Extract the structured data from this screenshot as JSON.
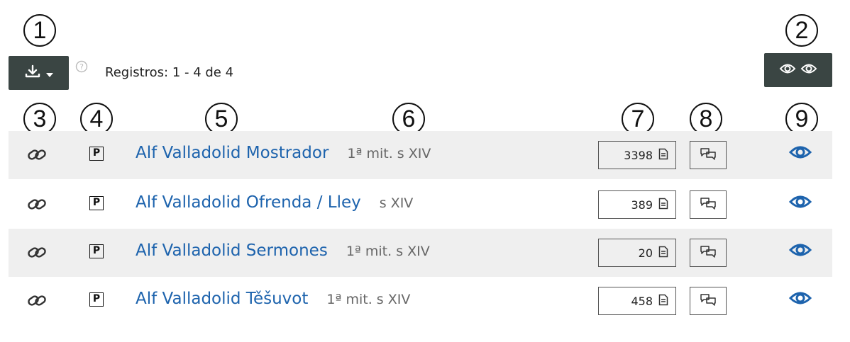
{
  "callouts": [
    "1",
    "2",
    "3",
    "4",
    "5",
    "6",
    "7",
    "8",
    "9"
  ],
  "toolbar": {
    "download_icon": "download-icon",
    "caret_icon": "caret-down-icon",
    "help_icon": "help-circle-icon",
    "records_label": "Registros: 1 - 4 de 4",
    "view_all_icon": "double-eye-icon"
  },
  "colors": {
    "button_bg": "#3a4543",
    "link": "#1d63ad",
    "row_shade": "#efefef",
    "eye": "#1d63ad"
  },
  "rows": [
    {
      "badge": "P",
      "title": "Alf Valladolid Mostrador",
      "date": "1ª mit. s XIV",
      "count": "3398"
    },
    {
      "badge": "P",
      "title": "Alf Valladolid Ofrenda / Lley",
      "date": "s XIV",
      "count": "389"
    },
    {
      "badge": "P",
      "title": "Alf Valladolid Sermones",
      "date": "1ª mit. s XIV",
      "count": "20"
    },
    {
      "badge": "P",
      "title": "Alf Valladolid Těšuvot",
      "date": "1ª mit. s XIV",
      "count": "458"
    }
  ]
}
